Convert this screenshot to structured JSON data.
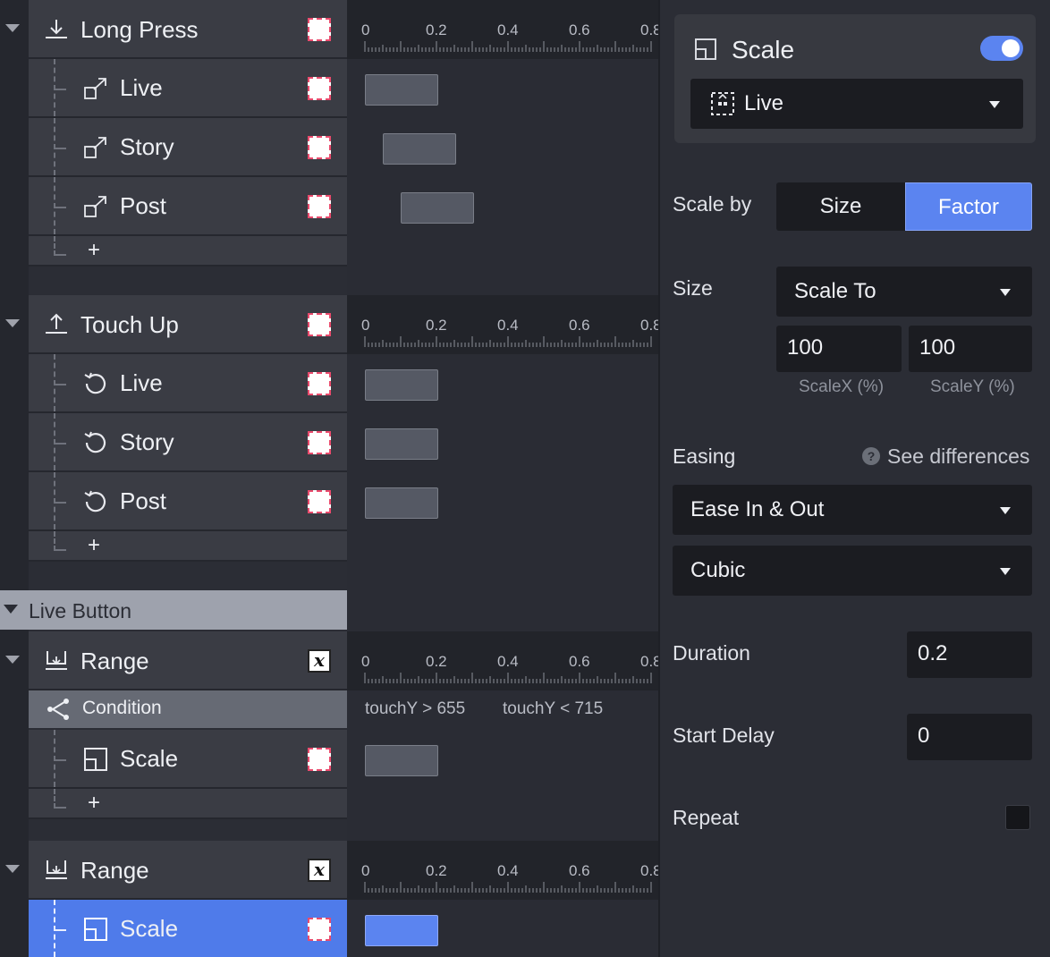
{
  "timeline": {
    "ticks": [
      "0",
      "0.2",
      "0.4",
      "0.6",
      "0.8"
    ],
    "groups": [
      {
        "label": "Long Press",
        "icon": "long-press-icon",
        "children": [
          {
            "label": "Live",
            "icon": "popout-icon"
          },
          {
            "label": "Story",
            "icon": "popout-icon"
          },
          {
            "label": "Post",
            "icon": "popout-icon"
          }
        ],
        "add": "+"
      },
      {
        "label": "Touch Up",
        "icon": "touch-up-icon",
        "children": [
          {
            "label": "Live",
            "icon": "rotate-icon"
          },
          {
            "label": "Story",
            "icon": "rotate-icon"
          },
          {
            "label": "Post",
            "icon": "rotate-icon"
          }
        ],
        "add": "+"
      }
    ],
    "section": {
      "label": "Live Button"
    },
    "range1": {
      "label": "Range",
      "icon": "range-icon",
      "variable_glyph": "x",
      "condition": {
        "label": "Condition",
        "expr1": "touchY > 655",
        "expr2": "touchY < 715"
      },
      "child": {
        "label": "Scale",
        "icon": "scale-icon"
      },
      "add": "+"
    },
    "range2": {
      "label": "Range",
      "icon": "range-icon",
      "variable_glyph": "x",
      "child": {
        "label": "Scale",
        "icon": "scale-icon"
      }
    }
  },
  "panel": {
    "title": "Scale",
    "toggle_on": true,
    "target": "Live",
    "scale_by": {
      "label": "Scale by",
      "options": [
        "Size",
        "Factor"
      ],
      "selected": "Factor"
    },
    "size": {
      "label": "Size",
      "mode": "Scale To",
      "x": "100",
      "y": "100",
      "x_caption": "ScaleX (%)",
      "y_caption": "ScaleY (%)"
    },
    "easing": {
      "label": "Easing",
      "help": "See differences",
      "type": "Ease In & Out",
      "curve": "Cubic"
    },
    "duration": {
      "label": "Duration",
      "value": "0.2"
    },
    "start_delay": {
      "label": "Start Delay",
      "value": "0"
    },
    "repeat": {
      "label": "Repeat",
      "checked": false
    }
  },
  "colors": {
    "accent": "#5b84f0",
    "row": "#3a3c44",
    "dark": "#1b1c21"
  }
}
